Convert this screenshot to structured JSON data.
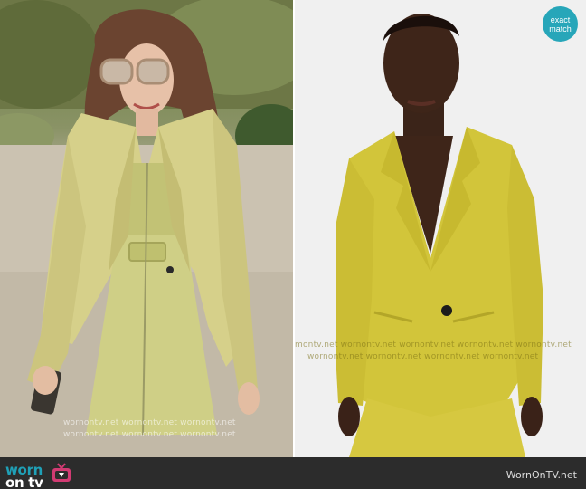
{
  "brand": {
    "logo_line1": "worn",
    "logo_line2": "on tv",
    "icon": "tv-icon",
    "accent_color": "#1fa0b7"
  },
  "badge": {
    "line1": "exact",
    "line2": "match",
    "color": "#27a6b9"
  },
  "credit": "WornOnTV.net",
  "watermarks": {
    "left_row1": "wornontv.net   wornontv.net   wornontv.net",
    "left_row2": "wornontv.net   wornontv.net   wornontv.net",
    "right_row1": "montv.net   wornontv.net   wornontv.net   wornontv.net   wornontv.net",
    "right_row2": "wornontv.net   wornontv.net   wornontv.net   wornontv.net"
  }
}
